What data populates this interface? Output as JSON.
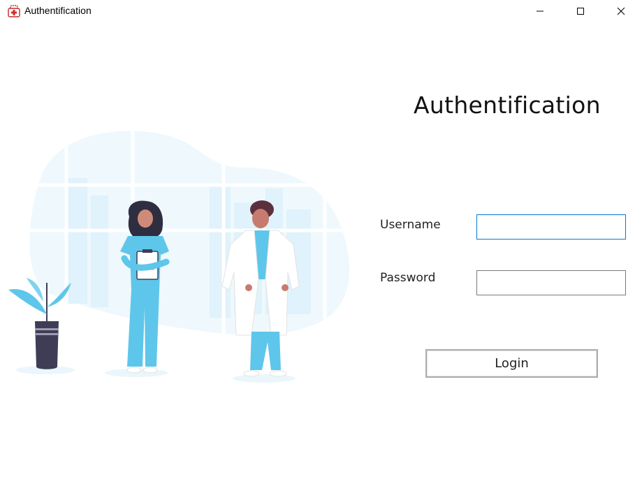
{
  "window": {
    "title": "Authentification",
    "icon": "medical-kit-icon",
    "controls": {
      "minimize_icon": "minimize-icon",
      "maximize_icon": "maximize-icon",
      "close_icon": "close-icon"
    }
  },
  "form": {
    "heading": "Authentification",
    "username_label": "Username",
    "username_value": "",
    "password_label": "Password",
    "password_value": "",
    "login_label": "Login"
  },
  "illustration": {
    "subject": "doctors-illustration"
  },
  "colors": {
    "accent_focus": "#0078d7",
    "scrubs": "#5ec6ea",
    "plant_leaves": "#5ec6ea",
    "background_blob": "#eef8fd",
    "button_border": "#adadad"
  }
}
